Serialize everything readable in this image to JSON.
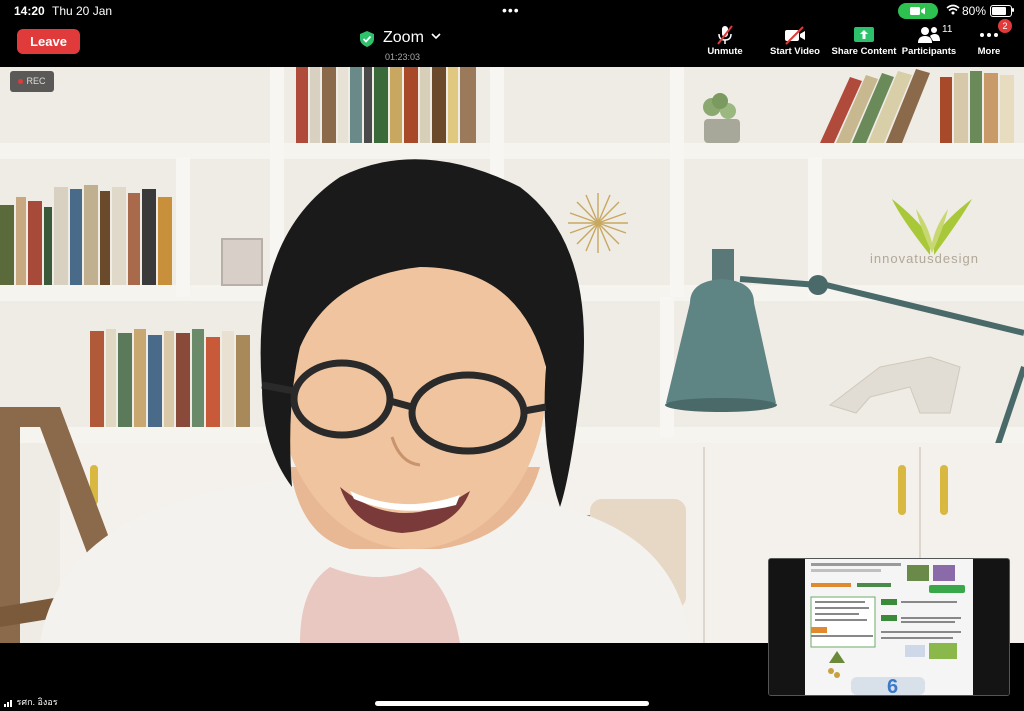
{
  "status_bar": {
    "time": "14:20",
    "date": "Thu 20 Jan",
    "battery_percent": "80%",
    "battery_level": 0.8
  },
  "toolbar": {
    "leave_label": "Leave",
    "meeting_title": "Zoom",
    "elapsed_time": "01:23:03",
    "unmute_label": "Unmute",
    "start_video_label": "Start Video",
    "share_content_label": "Share Content",
    "participants_label": "Participants",
    "participants_count": "11",
    "more_label": "More",
    "more_badge": "2"
  },
  "video": {
    "rec_label": "REC",
    "speaker_name": "รศก. อิงอร",
    "background_logo_text": "innovatusdesign"
  },
  "colors": {
    "leave_red": "#e03a3a",
    "share_green": "#2dc16c",
    "camera_pill_green": "#2fc150",
    "toolbar_bg": "#000000"
  }
}
